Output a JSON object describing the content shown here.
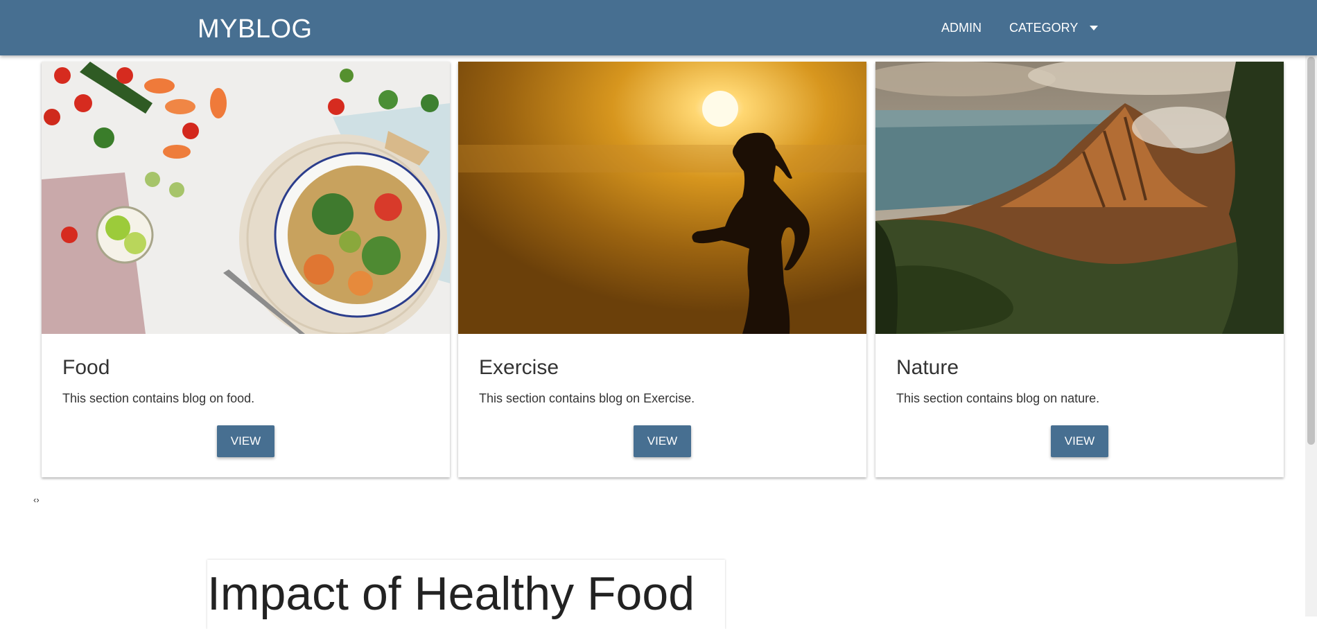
{
  "navbar": {
    "brand": "MYBLOG",
    "links": [
      {
        "label": "ADMIN"
      },
      {
        "label": "CATEGORY"
      }
    ]
  },
  "cards": [
    {
      "title": "Food",
      "text": "This section contains blog on food.",
      "button": "VIEW",
      "image": "food-bowl-photo"
    },
    {
      "title": "Exercise",
      "text": "This section contains blog on Exercise.",
      "button": "VIEW",
      "image": "runner-sunset-photo"
    },
    {
      "title": "Nature",
      "text": "This section contains blog on nature.",
      "button": "VIEW",
      "image": "mountain-coast-photo"
    }
  ],
  "pager": {
    "symbol": "‹›"
  },
  "article": {
    "title": "Impact of Healthy Food"
  },
  "colors": {
    "primary": "#476f91",
    "background": "#ffffff"
  }
}
